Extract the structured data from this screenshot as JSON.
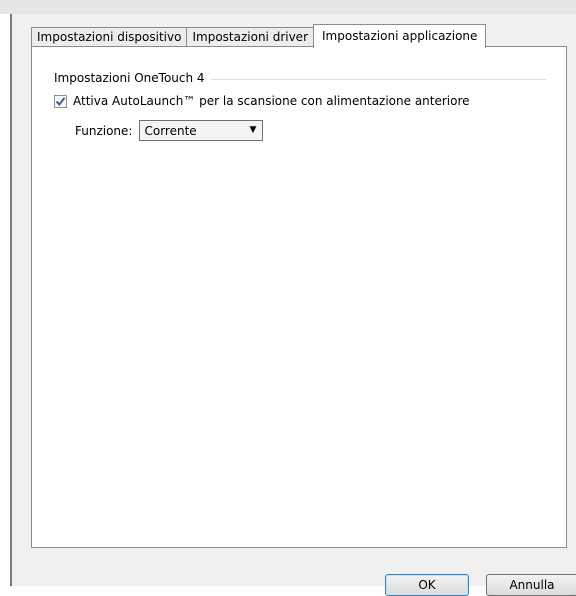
{
  "tabs": [
    {
      "label": "Impostazioni dispositivo"
    },
    {
      "label": "Impostazioni driver"
    },
    {
      "label": "Impostazioni applicazione",
      "active": true
    }
  ],
  "group": {
    "title": "Impostazioni OneTouch 4",
    "autolaunch_label": "Attiva AutoLaunch™ per la scansione con alimentazione anteriore",
    "autolaunch_checked": true,
    "function_label": "Funzione:",
    "function_selected": "Corrente"
  },
  "buttons": {
    "ok": "OK",
    "cancel": "Annulla"
  },
  "colors": {
    "dialog_bg": "#f0f0f0",
    "panel_bg": "#ffffff",
    "border": "#898c95",
    "check_mark": "#3a4f7a",
    "default_button_border": "#3c7fb1"
  }
}
